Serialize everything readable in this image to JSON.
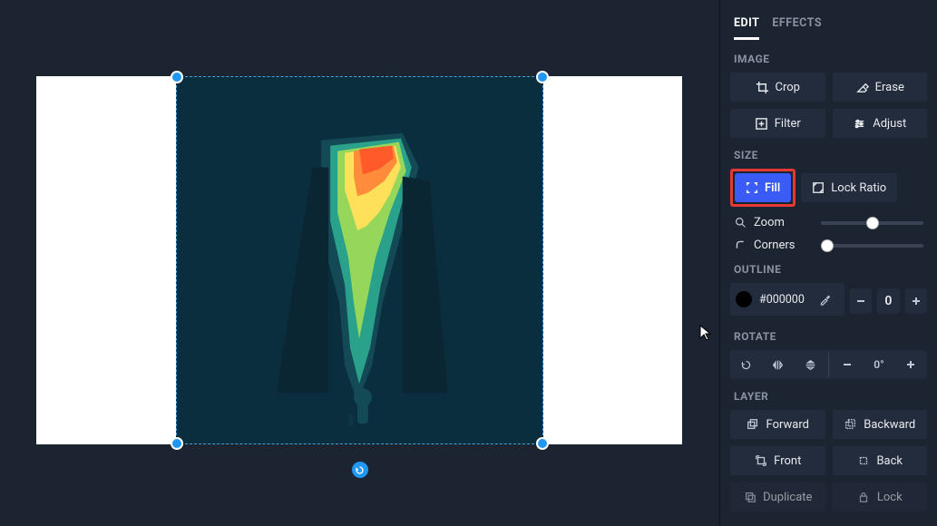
{
  "tabs": {
    "edit": "EDIT",
    "effects": "EFFECTS"
  },
  "sections": {
    "image": "IMAGE",
    "size": "SIZE",
    "outline": "OUTLINE",
    "rotate": "ROTATE",
    "layer": "LAYER"
  },
  "image": {
    "crop": "Crop",
    "erase": "Erase",
    "filter": "Filter",
    "adjust": "Adjust"
  },
  "size": {
    "fill": "Fill",
    "lock_ratio": "Lock Ratio",
    "zoom_label": "Zoom",
    "zoom_percent": 50,
    "corners_label": "Corners",
    "corners_percent": 0
  },
  "outline": {
    "hex": "#000000",
    "width": "0"
  },
  "rotate": {
    "angle": "0°"
  },
  "layer": {
    "forward": "Forward",
    "backward": "Backward",
    "front": "Front",
    "back": "Back",
    "duplicate": "Duplicate",
    "lock": "Lock"
  }
}
